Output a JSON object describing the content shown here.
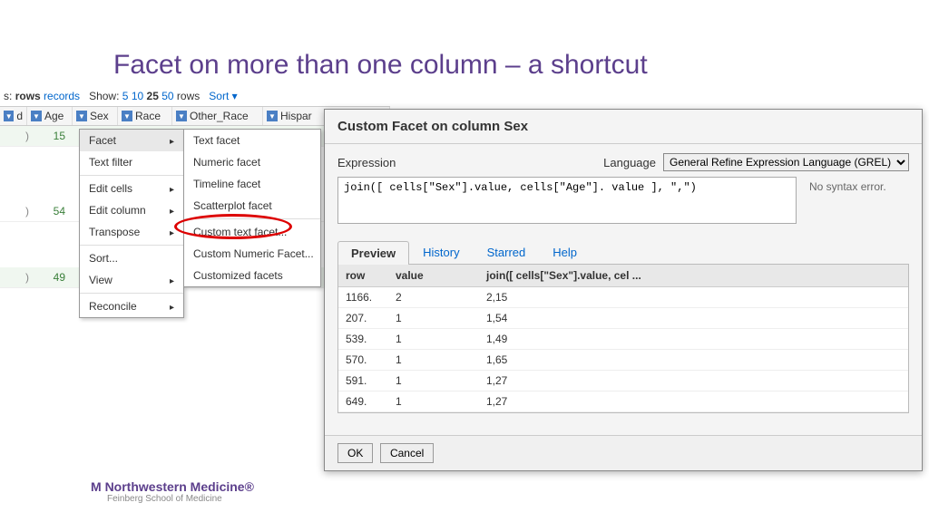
{
  "slide_title": "Facet on more than one column – a shortcut",
  "grid": {
    "toolbar": {
      "prefix": "s:",
      "rows_label": "rows",
      "records_link": "records",
      "show_label": "Show:",
      "options": [
        "5",
        "10",
        "25",
        "50"
      ],
      "active_option": "25",
      "rows_suffix": "rows",
      "sort_label": "Sort"
    },
    "columns": [
      "d",
      "Age",
      "Sex",
      "Race",
      "Other_Race",
      "Hispar"
    ],
    "rows": [
      {
        "age": "15"
      },
      {
        "age": "54"
      },
      {
        "age": "49"
      }
    ]
  },
  "menu": {
    "items": [
      {
        "label": "Facet",
        "arrow": true,
        "hover": true
      },
      {
        "label": "Text filter"
      },
      {
        "sep": true
      },
      {
        "label": "Edit cells",
        "arrow": true
      },
      {
        "label": "Edit column",
        "arrow": true
      },
      {
        "label": "Transpose",
        "arrow": true
      },
      {
        "sep": true
      },
      {
        "label": "Sort..."
      },
      {
        "label": "View",
        "arrow": true
      },
      {
        "sep": true
      },
      {
        "label": "Reconcile",
        "arrow": true
      }
    ]
  },
  "submenu": {
    "items": [
      {
        "label": "Text facet"
      },
      {
        "label": "Numeric facet"
      },
      {
        "label": "Timeline facet"
      },
      {
        "label": "Scatterplot facet"
      },
      {
        "sep": true
      },
      {
        "label": "Custom text facet..."
      },
      {
        "label": "Custom Numeric Facet..."
      },
      {
        "label": "Customized facets"
      }
    ]
  },
  "dialog": {
    "title": "Custom Facet on column Sex",
    "expression_label": "Expression",
    "language_label": "Language",
    "language_value": "General Refine Expression Language (GREL)",
    "expression_value": "join([ cells[\"Sex\"].value, cells[\"Age\"]. value ], \",\")",
    "syntax_msg": "No syntax error.",
    "tabs": [
      "Preview",
      "History",
      "Starred",
      "Help"
    ],
    "preview": {
      "headers": [
        "row",
        "value",
        "join([ cells[\"Sex\"].value, cel ..."
      ],
      "rows": [
        {
          "row": "1166.",
          "value": "2",
          "result": "2,15"
        },
        {
          "row": "207.",
          "value": "1",
          "result": "1,54"
        },
        {
          "row": "539.",
          "value": "1",
          "result": "1,49"
        },
        {
          "row": "570.",
          "value": "1",
          "result": "1,65"
        },
        {
          "row": "591.",
          "value": "1",
          "result": "1,27"
        },
        {
          "row": "649.",
          "value": "1",
          "result": "1,27"
        }
      ]
    },
    "ok_label": "OK",
    "cancel_label": "Cancel"
  },
  "footer": {
    "main": "Northwestern Medicine",
    "sub": "Feinberg School of Medicine"
  }
}
